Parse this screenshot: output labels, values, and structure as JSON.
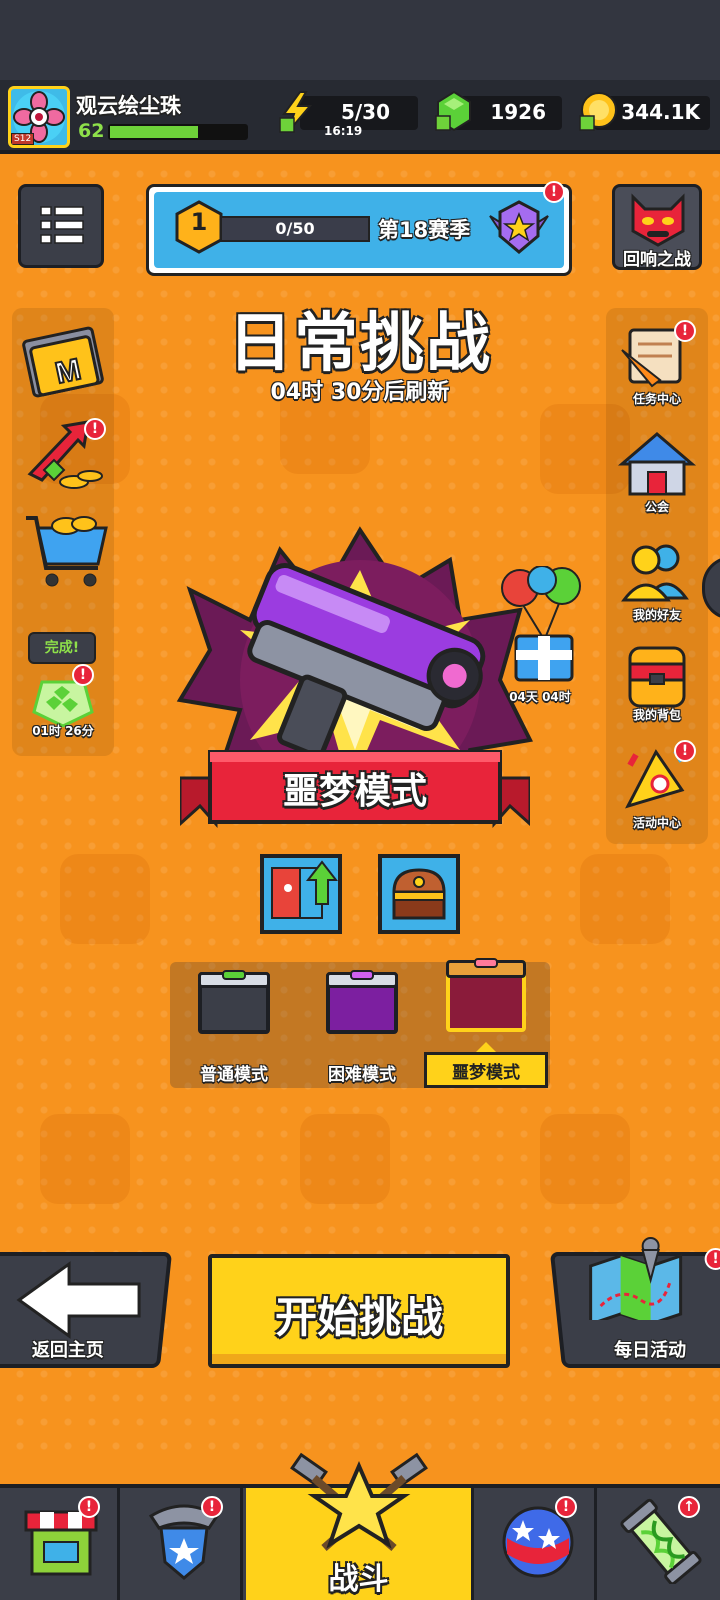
{
  "player": {
    "name": "观云绘尘珠",
    "level": "62",
    "rank": "S12",
    "xp_fraction": 0.65
  },
  "resources": {
    "energy": "5/30",
    "energy_timer": "16:19",
    "gems": "1926",
    "gold": "344.1K"
  },
  "season": {
    "level": "1",
    "progress": "0/50",
    "progress_fraction": 0,
    "label": "第18赛季"
  },
  "echo_battle": {
    "label": "回响之战"
  },
  "title": {
    "main": "日常挑战",
    "refresh": "04时 30分后刷新"
  },
  "left_side": {
    "complete_label": "完成!",
    "timer": "01时 26分"
  },
  "right_side": {
    "items": [
      {
        "label": "任务中心"
      },
      {
        "label": "公会"
      },
      {
        "label": "我的好友"
      },
      {
        "label": "我的背包"
      },
      {
        "label": "活动中心"
      }
    ]
  },
  "gift": {
    "timer": "04天 04时"
  },
  "mode_banner": "噩梦模式",
  "modes": [
    {
      "label": "普通模式",
      "color": "#3b3e48"
    },
    {
      "label": "困难模式",
      "color": "#7c1fa0"
    },
    {
      "label": "噩梦模式",
      "color": "#8a1b3a"
    }
  ],
  "selected_mode": "噩梦模式",
  "buttons": {
    "back": "返回主页",
    "start": "开始挑战",
    "daily": "每日活动"
  },
  "nav": {
    "battle": "战斗"
  },
  "colors": {
    "accent": "#f7931e",
    "yellow": "#ffd21a",
    "red": "#e8243a",
    "dark": "#272a32"
  }
}
